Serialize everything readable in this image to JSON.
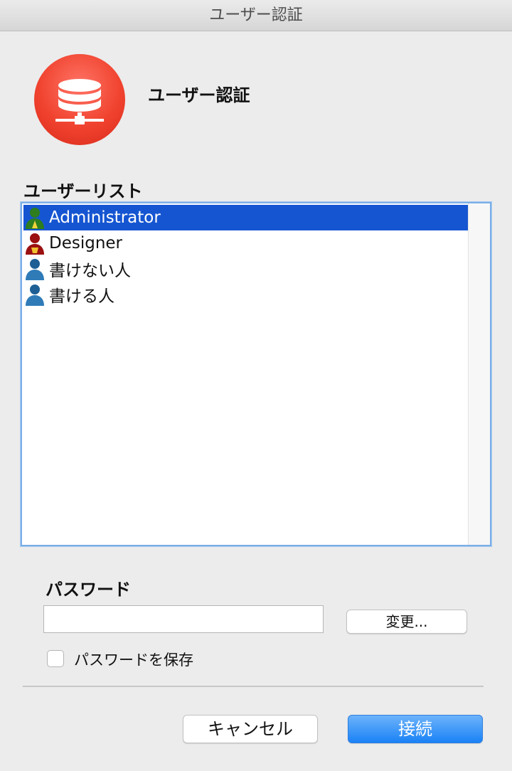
{
  "window": {
    "title": "ユーザー認証"
  },
  "header": {
    "title": "ユーザー認証",
    "icon": "database-network-icon"
  },
  "user_list": {
    "label": "ユーザーリスト",
    "items": [
      {
        "name": "Administrator",
        "icon": "user-admin-icon",
        "selected": true,
        "color": "#2e7d1f"
      },
      {
        "name": "Designer",
        "icon": "user-designer-icon",
        "selected": false,
        "color": "#9b1010"
      },
      {
        "name": "書けない人",
        "icon": "user-icon",
        "selected": false,
        "color": "#1d5f95"
      },
      {
        "name": "書ける人",
        "icon": "user-icon",
        "selected": false,
        "color": "#1d5f95"
      }
    ]
  },
  "password": {
    "label": "パスワード",
    "value": "",
    "change_button": "変更...",
    "save_checkbox_label": "パスワードを保存",
    "save_checked": false
  },
  "actions": {
    "cancel": "キャンセル",
    "connect": "接続"
  },
  "colors": {
    "accent": "#1555d1",
    "primary_button": "#1a82f6",
    "icon_bg": "#f0432f"
  }
}
